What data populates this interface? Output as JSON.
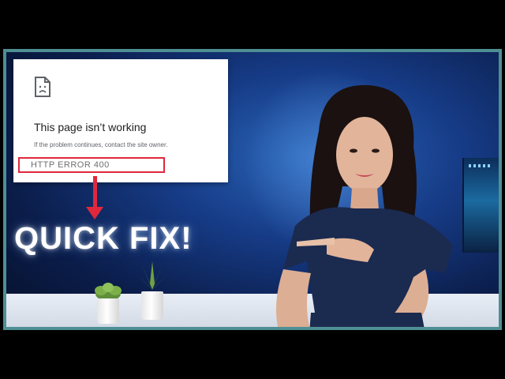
{
  "error_card": {
    "title": "This page isn’t working",
    "subtitle": "If the problem continues, contact the site owner.",
    "error_code": "HTTP ERROR 400"
  },
  "headline": "QUICK FIX!",
  "icons": [
    "sad-document-icon",
    "down-arrow"
  ],
  "colors": {
    "frame": "#4e8f94",
    "highlight": "#e0283c",
    "background_blue": "#163b86"
  }
}
